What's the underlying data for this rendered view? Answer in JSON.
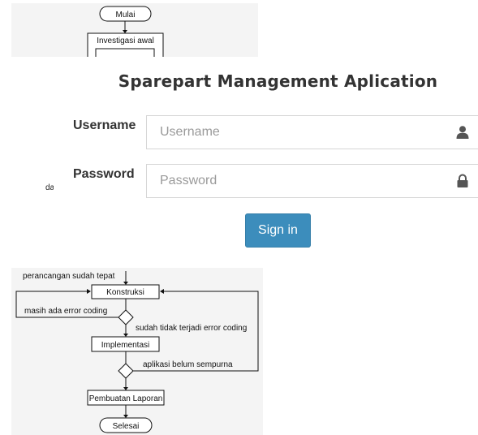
{
  "flowchart": {
    "start_label": "Mulai",
    "step_investigation": "Investigasi awal",
    "note_design_ok": "perancangan sudah tepat",
    "step_construction": "Konstruksi",
    "note_error_coding": "masih ada error coding",
    "note_no_error": "sudah tidak terjadi error coding",
    "step_implementation": "Implementasi",
    "note_not_perfect": "aplikasi belum sempurna",
    "step_report": "Pembuatan Laporan",
    "end_label": "Selesai",
    "stray_text": "da"
  },
  "login": {
    "title": "Sparepart Management Aplication",
    "username_label": "Username",
    "username_placeholder": "Username",
    "username_icon": "user-icon",
    "password_label": "Password",
    "password_placeholder": "Password",
    "password_icon": "lock-icon",
    "signin_label": "Sign in",
    "accent_color": "#3c8dbc"
  }
}
